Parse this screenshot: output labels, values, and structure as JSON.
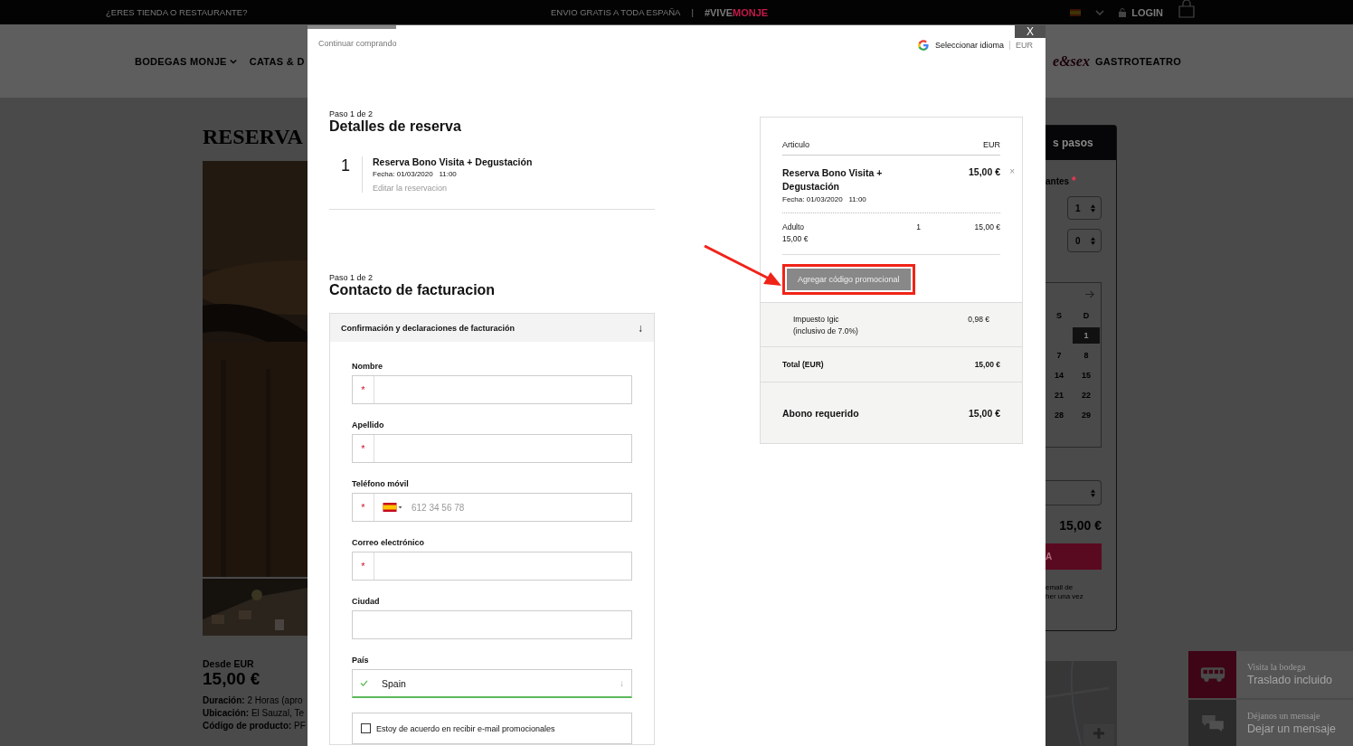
{
  "top_bar": {
    "left_link": "¿ERES TIENDA O RESTAURANTE?",
    "shipping": "ENVIO GRATIS A TODA ESPAÑA",
    "separator": "|",
    "hashtag": "#VIVE",
    "hashtag_accent": "MONJE",
    "login": "LOGIN"
  },
  "nav": {
    "items": [
      {
        "label": "BODEGAS MONJE",
        "dropdown": true
      },
      {
        "label": "CATAS & D"
      }
    ],
    "logo_partial": "e&sex",
    "right_item": "GASTROTEATRO"
  },
  "product": {
    "title": "RESERVA",
    "price_label": "Desde EUR",
    "price": "15,00 €",
    "details": [
      {
        "label": "Duración:",
        "value": "2 Horas (apro"
      },
      {
        "label": "Ubicación:",
        "value": "El Sauzal, Te"
      },
      {
        "label": "Código de producto:",
        "value": "PF"
      }
    ]
  },
  "booking_panel": {
    "header": "s pasos",
    "participants_label": "antes",
    "required_mark": "*",
    "quantities": [
      "1",
      "0"
    ],
    "calendar": {
      "weekdays": [
        "S",
        "D"
      ],
      "days": [
        {
          "label": "1",
          "selected": true
        },
        {
          "label": "7",
          "selected": false
        },
        {
          "label": "8",
          "selected": false
        },
        {
          "label": "14",
          "selected": false
        },
        {
          "label": "15",
          "selected": false
        },
        {
          "label": "21",
          "selected": false
        },
        {
          "label": "22",
          "selected": false
        },
        {
          "label": "28",
          "selected": false
        },
        {
          "label": "29",
          "selected": false
        }
      ]
    },
    "total": "15,00 €",
    "button": "A",
    "note": [
      "email de",
      "her una vez"
    ]
  },
  "widgets": [
    {
      "kind": "bus",
      "subtitle": "Visita la bodega",
      "title": "Traslado incluido"
    },
    {
      "kind": "chat",
      "subtitle": "Déjanos un mensaje",
      "title": "Dejar un mensaje"
    }
  ],
  "modal": {
    "progress": {
      "level": 0.12
    },
    "continue_link": "Continuar comprando",
    "language": "Seleccionar idioma",
    "currency": "EUR",
    "close": "X",
    "booking": {
      "step": "Paso 1 de 2",
      "title": "Detalles de reserva",
      "item": {
        "number": "1",
        "name": "Reserva Bono Visita + Degustación",
        "date": "Fecha: 01/03/2020   11:00",
        "edit_link": "Editar la reservacion"
      }
    },
    "billing": {
      "step": "Paso 1 de 2",
      "title": "Contacto de facturacion",
      "section": {
        "title": "Confirmación y declaraciones de facturación",
        "toggle": "↓",
        "expanded": true
      },
      "fields": [
        {
          "kind": "text",
          "label": "Nombre",
          "required": true
        },
        {
          "kind": "text",
          "label": "Apellido",
          "required": true
        },
        {
          "kind": "phone",
          "label": "Teléfono móvil",
          "required": true,
          "placeholder": "612 34 56 78"
        },
        {
          "kind": "text",
          "label": "Correo electrónico",
          "required": true
        },
        {
          "kind": "text",
          "label": "Ciudad",
          "required": false
        },
        {
          "kind": "select",
          "label": "País",
          "required": false,
          "value": "Spain",
          "valid": true,
          "arrow": "↓"
        }
      ],
      "required_mark": "*",
      "consent": {
        "label": "Estoy de acuerdo en recibir e-mail promocionales",
        "checked": false
      }
    },
    "summary": {
      "columns": [
        "Articulo",
        "EUR"
      ],
      "item": {
        "name": "Reserva Bono Visita + Degustación",
        "price": "15,00 €",
        "date": "Fecha: 01/03/2020   11:00",
        "remove": "×"
      },
      "lines": [
        {
          "name": "Adulto",
          "unit_price": "15,00 €",
          "quantity": "1",
          "amount": "15,00 €"
        }
      ],
      "promo_button": "Agregar código promocional",
      "promo_highlighted": true,
      "tax": {
        "label": "Impuesto Igic",
        "note": "(inclusivo de 7.0%)",
        "amount": "0,98 €"
      },
      "total": {
        "label": "Total (EUR)",
        "amount": "15,00 €"
      },
      "deposit": {
        "label": "Abono requerido",
        "amount": "15,00 €"
      }
    }
  }
}
